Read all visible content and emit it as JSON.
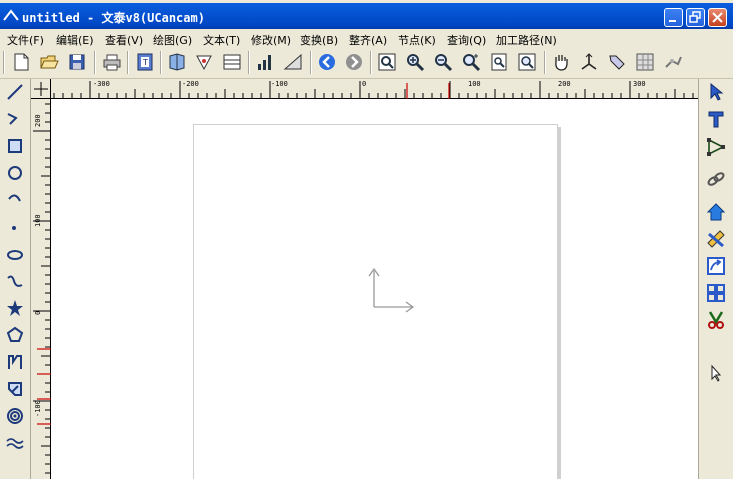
{
  "window": {
    "title": "untitled - 文泰v8(UCancam)"
  },
  "menu": [
    "文件(F)",
    "编辑(E)",
    "查看(V)",
    "绘图(G)",
    "文本(T)",
    "修改(M)",
    "变换(B)",
    "整齐(A)",
    "节点(K)",
    "查询(Q)",
    "加工路径(N)"
  ],
  "ruler": {
    "h_labels": [
      "-300",
      "-200",
      "-100",
      "0",
      "100",
      "200",
      "300"
    ],
    "v_labels": [
      "200",
      "100",
      "0",
      "-100"
    ]
  },
  "colors": {
    "title_bar": "#0553d2",
    "face": "#ece9d8",
    "canvas": "#ffffff",
    "ruler_red": "#cc0000"
  },
  "toolbar_icons": [
    "new-icon",
    "open-icon",
    "save-icon",
    "print-icon",
    "import-icon",
    "export-icon",
    "vector-icon",
    "sheet-icon",
    "measure-icon",
    "angle-icon",
    "undo-icon",
    "redo-icon",
    "zoom-window-icon",
    "zoom-in-icon",
    "zoom-out-icon",
    "zoom-selection-icon",
    "zoom-page-icon",
    "zoom-all-icon",
    "pan-hand-icon",
    "origin-icon",
    "bevel-icon",
    "grid-icon",
    "engrave-icon"
  ],
  "left_tools": [
    "line-icon",
    "polyline-icon",
    "rectangle-icon",
    "circle-icon",
    "arc-icon",
    "point-icon",
    "ellipse-icon",
    "spline-icon",
    "star-icon",
    "polygon-icon",
    "text-path-icon",
    "arrow-shape-icon",
    "spiral-icon",
    "wave-icon"
  ],
  "right_tools": [
    "select-arrow-icon",
    "text-tool-icon",
    "node-edit-icon",
    "link-icon",
    "home-shape-icon",
    "ruler-pencil-icon",
    "transform-icon",
    "array-icon",
    "knife-icon",
    "pointer-icon"
  ]
}
